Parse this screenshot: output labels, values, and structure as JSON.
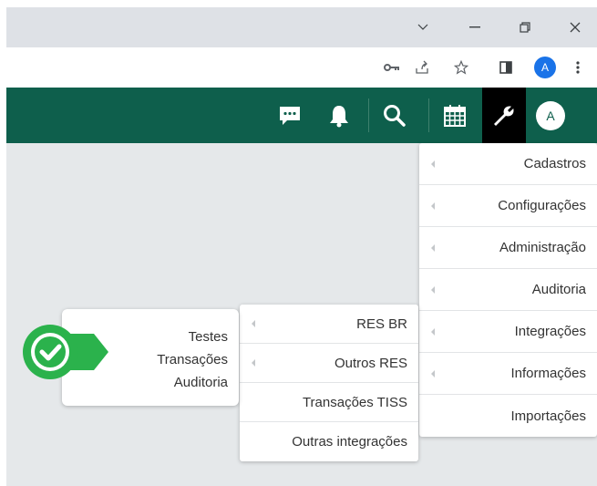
{
  "browser": {
    "window_controls": {
      "dropdown_icon": "chevron-down-icon",
      "minimize_icon": "minimize-icon",
      "restore_icon": "restore-icon",
      "close_icon": "close-icon"
    },
    "toolbar": {
      "icons": [
        "key-icon",
        "share-icon",
        "star-icon",
        "sidepanel-icon"
      ],
      "profile_initial": "A",
      "profile_color": "#1a73e8"
    }
  },
  "app_header": {
    "background": "#0e5f4c",
    "icons": [
      "chat-icon",
      "bell-icon",
      "search-icon",
      "calendar-icon",
      "wrench-icon"
    ],
    "avatar_initial": "A"
  },
  "main_menu": {
    "items": [
      {
        "label": "Cadastros",
        "has_submenu": true
      },
      {
        "label": "Configurações",
        "has_submenu": true
      },
      {
        "label": "Administração",
        "has_submenu": true
      },
      {
        "label": "Auditoria",
        "has_submenu": true
      },
      {
        "label": "Integrações",
        "has_submenu": true
      },
      {
        "label": "Informações",
        "has_submenu": true
      },
      {
        "label": "Importações",
        "has_submenu": false
      }
    ]
  },
  "integracoes_submenu": {
    "items": [
      {
        "label": "RES BR",
        "has_submenu": true
      },
      {
        "label": "Outros RES",
        "has_submenu": true
      },
      {
        "label": "Transações TISS",
        "has_submenu": false
      },
      {
        "label": "Outras integrações",
        "has_submenu": false
      }
    ]
  },
  "testes_menu": {
    "items": [
      "Testes",
      "Transações",
      "Auditoria"
    ]
  },
  "status_badge": {
    "icon": "check-icon",
    "color": "#2bb24c"
  }
}
